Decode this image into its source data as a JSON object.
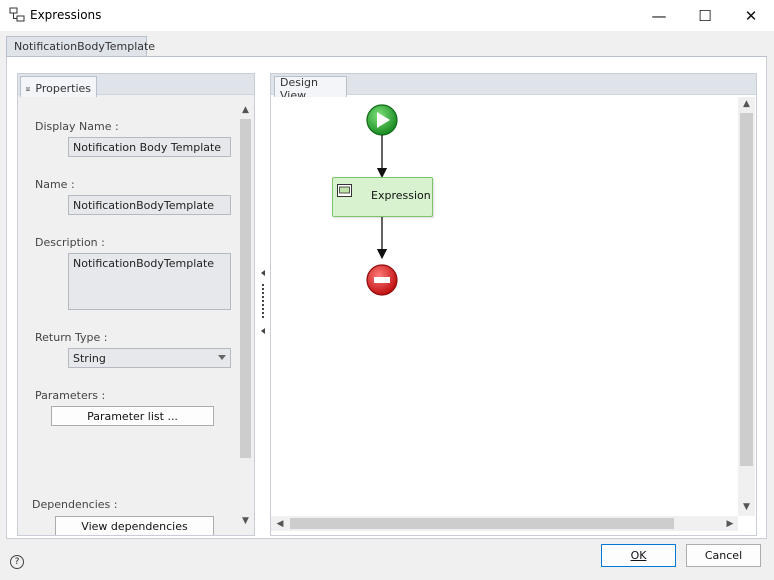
{
  "window": {
    "title": "Expressions",
    "minimize": "—",
    "maximize": "☐",
    "close": "✕"
  },
  "top_tab": {
    "label": "NotificationBodyTemplate"
  },
  "properties": {
    "tab_label": "Properties",
    "display_name": {
      "label": "Display Name :",
      "value": "Notification Body Template"
    },
    "name": {
      "label": "Name :",
      "value": "NotificationBodyTemplate"
    },
    "description": {
      "label": "Description :",
      "value": "NotificationBodyTemplate"
    },
    "return_type": {
      "label": "Return Type :",
      "value": "String"
    },
    "parameters": {
      "label": "Parameters :",
      "button": "Parameter list ..."
    },
    "dependencies": {
      "label": "Dependencies :",
      "button": "View dependencies"
    }
  },
  "design_view": {
    "tab_label": "Design View",
    "expression_label": "Expression"
  },
  "footer": {
    "help": "?",
    "ok": "OK",
    "cancel": "Cancel"
  },
  "colors": {
    "accent_blue": "#0078d7",
    "start_green": "#1f9d2a",
    "stop_red": "#d62020",
    "expression_fill": "#d8f2cf",
    "expression_border": "#7cc46b"
  }
}
